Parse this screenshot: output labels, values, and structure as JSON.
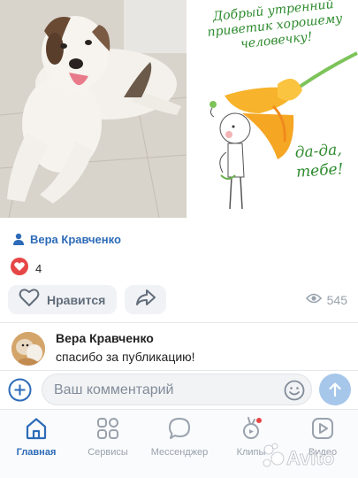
{
  "post": {
    "card_text": {
      "greeting": "Добрый утренний приветик хорошему человечку!",
      "reply": "да-да, тебе!"
    },
    "author": {
      "name": "Вера Кравченко",
      "icon": "person-icon"
    },
    "reactions": {
      "like_count": "4",
      "icon": "heart-reaction-icon"
    },
    "actions": {
      "like_label": "Нравится",
      "views_count": "545"
    }
  },
  "comment": {
    "author": "Вера Кравченко",
    "text": "спасибо за публикацию!"
  },
  "composer": {
    "placeholder": "Ваш комментарий"
  },
  "tabbar": {
    "items": [
      {
        "label": "Главная",
        "icon": "home-icon",
        "active": true
      },
      {
        "label": "Сервисы",
        "icon": "services-icon",
        "active": false
      },
      {
        "label": "Мессенджер",
        "icon": "messenger-icon",
        "active": false
      },
      {
        "label": "Клипы",
        "icon": "clips-icon",
        "active": false
      },
      {
        "label": "Видео",
        "icon": "video-icon",
        "active": false
      }
    ]
  },
  "colors": {
    "accent": "#2d6bb8",
    "like_red": "#e64646",
    "greeting_green": "#2e8b2e"
  },
  "watermark": "Avito"
}
